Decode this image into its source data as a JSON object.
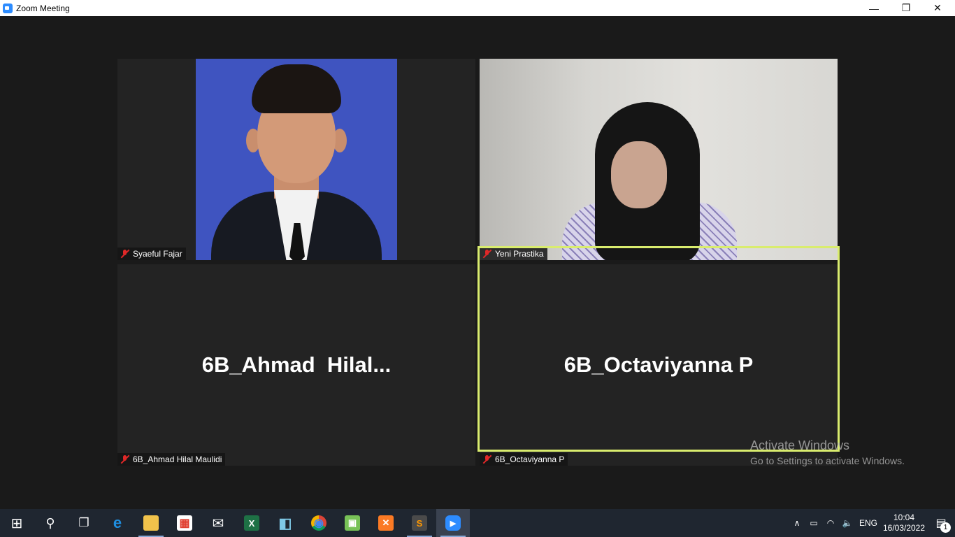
{
  "window": {
    "title": "Zoom Meeting",
    "controls": {
      "minimize": "—",
      "maximize": "❐",
      "close": "✕"
    }
  },
  "participants": [
    {
      "tag": "Syaeful Fajar",
      "mic": "muted",
      "video": "on"
    },
    {
      "tag": "Yeni Prastika",
      "mic": "muted",
      "video": "on"
    },
    {
      "display": "6B_Ahmad  Hilal...",
      "tag": "6B_Ahmad Hilal Maulidi",
      "mic": "muted",
      "video": "off"
    },
    {
      "display": "6B_Octaviyanna P",
      "tag": "6B_Octaviyanna P",
      "mic": "muted",
      "video": "off",
      "active_speaker": true
    }
  ],
  "watermark": {
    "title": "Activate Windows",
    "subtitle": "Go to Settings to activate Windows."
  },
  "taskbar": {
    "items": [
      {
        "name": "start-icon",
        "glyph": "⊞"
      },
      {
        "name": "search-icon",
        "glyph": "⚲"
      },
      {
        "name": "task-view-icon",
        "glyph": "❐"
      },
      {
        "name": "edge-icon",
        "glyph": "e"
      },
      {
        "name": "file-explorer-icon",
        "glyph": "▬"
      },
      {
        "name": "store-icon",
        "glyph": "▦"
      },
      {
        "name": "mail-icon",
        "glyph": "✉"
      },
      {
        "name": "excel-icon",
        "glyph": "X"
      },
      {
        "name": "notes-icon",
        "glyph": "◧"
      },
      {
        "name": "chrome-icon",
        "glyph": "◉"
      },
      {
        "name": "android-studio-icon",
        "glyph": "▣"
      },
      {
        "name": "xampp-icon",
        "glyph": "✕"
      },
      {
        "name": "sublime-text-icon",
        "glyph": "S"
      },
      {
        "name": "zoom-icon",
        "glyph": "▶"
      }
    ],
    "tray": {
      "chevron": "∧",
      "battery": "▭",
      "wifi": "◠",
      "volume": "🔈",
      "language": "ENG",
      "time": "10:04",
      "date": "16/03/2022",
      "notifications_count": "1"
    }
  },
  "colors": {
    "active_speaker_border": "#d9ec6e",
    "muted_icon": "#e02828",
    "taskbar": "#1f2630"
  }
}
